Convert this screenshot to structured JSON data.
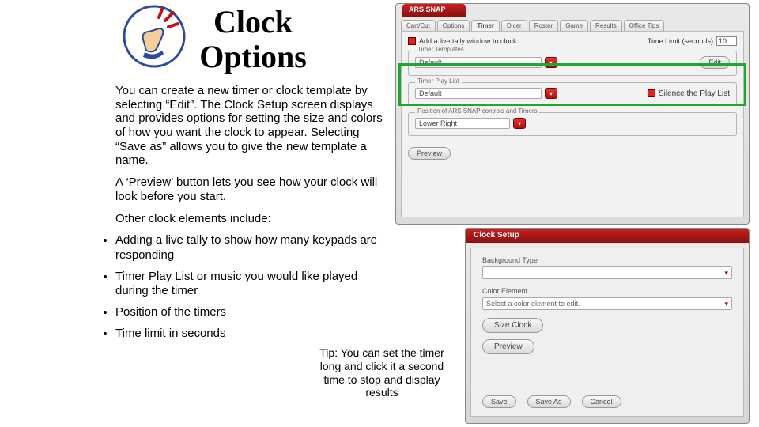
{
  "title_line1": "Clock",
  "title_line2": "Options",
  "para1": "You can create a new timer or clock template by selecting “Edit”.  The Clock Setup screen displays and provides options for setting the size and colors of how you want the clock to appear.  Selecting “Save as” allows you to give the new template a name.",
  "para2": " A ‘Preview’ button lets you see how your clock will look before you start.",
  "para3": "Other clock elements include:",
  "bullets": [
    "Adding a live tally to show how many keypads are responding",
    "Timer Play List or music you would like played during the timer",
    "Position of the timers",
    "Time limit in seconds"
  ],
  "tip": "Tip:  You can set the timer long and click it a second time to stop and display results",
  "app1": {
    "title": "ARS SNAP",
    "tabs": [
      "Cart/Cut",
      "Options",
      "Timer",
      "Dicer",
      "Roster",
      "Game",
      "Results",
      "Office Tips"
    ],
    "active_tab_index": 2,
    "tally_checkbox": "Add a live tally window to clock",
    "time_limit_label": "Time Limit (seconds)",
    "time_limit_value": "10",
    "fs_templates": {
      "legend": "Timer Templates",
      "value": "Default",
      "edit": "Edit"
    },
    "fs_playlist": {
      "legend": "Timer Play List",
      "value": "Default",
      "silence": "Silence the Play List"
    },
    "fs_position": {
      "legend": "Position of ARS SNAP controls and Timers",
      "value": "Lower Right"
    },
    "preview": "Preview"
  },
  "app2": {
    "title": "Clock Setup",
    "bg_label": "Background Type",
    "bg_value": "",
    "color_label": "Color Element",
    "color_value": "Select a color element to edit.",
    "size_btn": "Size Clock",
    "preview_btn": "Preview",
    "save": "Save",
    "saveas": "Save As",
    "cancel": "Cancel"
  }
}
